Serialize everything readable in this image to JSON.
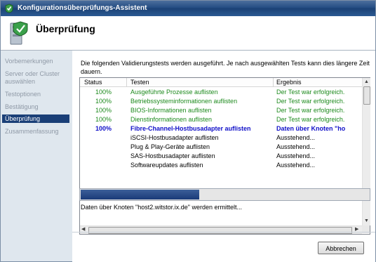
{
  "window": {
    "title": "Konfigurationsüberprüfungs-Assistent",
    "heading": "Überprüfung"
  },
  "sidebar": {
    "items": [
      {
        "label": "Vorbemerkungen",
        "active": false
      },
      {
        "label": "Server oder Cluster auswählen",
        "active": false
      },
      {
        "label": "Testoptionen",
        "active": false
      },
      {
        "label": "Bestätigung",
        "active": false
      },
      {
        "label": "Überprüfung",
        "active": true
      },
      {
        "label": "Zusammenfassung",
        "active": false
      }
    ]
  },
  "main": {
    "intro": "Die folgenden Validierungstests werden ausgeführt. Je nach ausgewählten Tests kann dies längere Zeit dauern.",
    "columns": [
      "Status",
      "Testen",
      "Ergebnis"
    ],
    "rows": [
      {
        "status": "100%",
        "test": "Ausgeführte Prozesse auflisten",
        "result": "Der Test war erfolgreich.",
        "state": "ok"
      },
      {
        "status": "100%",
        "test": "Betriebssysteminformationen auflisten",
        "result": "Der Test war erfolgreich.",
        "state": "ok"
      },
      {
        "status": "100%",
        "test": "BIOS-Informationen auflisten",
        "result": "Der Test war erfolgreich.",
        "state": "ok"
      },
      {
        "status": "100%",
        "test": "Dienstinformationen auflisten",
        "result": "Der Test war erfolgreich.",
        "state": "ok"
      },
      {
        "status": "100%",
        "test": "Fibre-Channel-Hostbusadapter auflisten",
        "result": "Daten über Knoten \"ho",
        "state": "current"
      },
      {
        "status": "",
        "test": "iSCSI-Hostbusadapter auflisten",
        "result": "Ausstehend...",
        "state": "pending"
      },
      {
        "status": "",
        "test": "Plug & Play-Geräte auflisten",
        "result": "Ausstehend...",
        "state": "pending"
      },
      {
        "status": "",
        "test": "SAS-Hostbusadapter auflisten",
        "result": "Ausstehend...",
        "state": "pending"
      },
      {
        "status": "",
        "test": "Softwareupdates auflisten",
        "result": "Ausstehend...",
        "state": "pending"
      }
    ],
    "progress_fraction": 0.41,
    "status_text": "Daten über Knoten \"host2.witstor.ix.de\" werden ermittelt..."
  },
  "footer": {
    "cancel_label": "Abbrechen"
  },
  "colors": {
    "ok": "#1d8a1d",
    "current": "#1010c8",
    "sidebar_active": "#1a3f77"
  }
}
